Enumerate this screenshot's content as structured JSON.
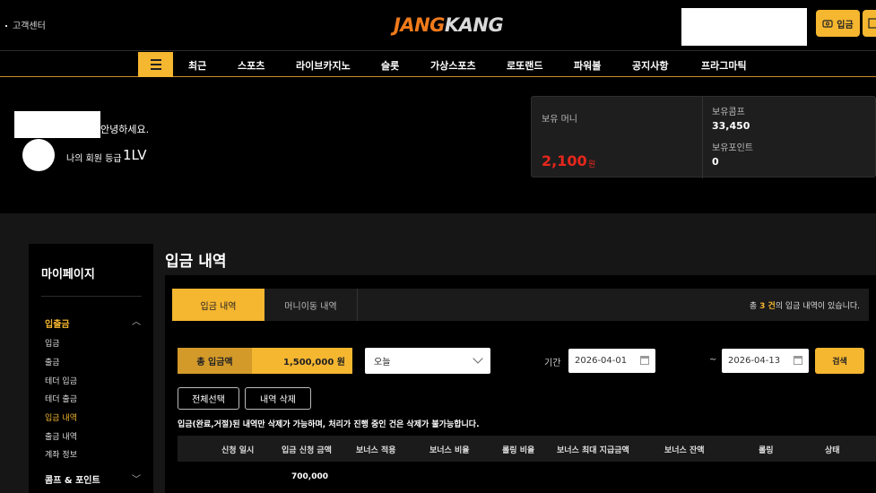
{
  "header": {
    "support_label": "고객센터",
    "logo_part1": "JANG",
    "logo_part2": "KANG",
    "deposit_button": "입금"
  },
  "nav": {
    "items": [
      "최근",
      "스포츠",
      "라이브카지노",
      "슬롯",
      "가상스포츠",
      "로또랜드",
      "파워볼",
      "공지사항",
      "프라그마틱"
    ]
  },
  "user": {
    "greeting": "안녕하세요.",
    "grade_label": "나의 회원 등급",
    "grade_value": "1LV"
  },
  "wallet": {
    "money_label": "보유 머니",
    "money_value": "2,100",
    "money_unit": "원",
    "comp_label": "보유콤프",
    "comp_value": "33,450",
    "point_label": "보유포인트",
    "point_value": "0"
  },
  "sidebar": {
    "title": "마이페이지",
    "group1": "입출금",
    "items": [
      "입금",
      "출금",
      "테더 입금",
      "테더 출금",
      "입금 내역",
      "출금 내역",
      "계좌 정보"
    ],
    "group2": "콤프 & 포인트"
  },
  "page": {
    "title": "입금 내역"
  },
  "tabs": {
    "active": "입금 내역",
    "inactive": "머니이동 내역",
    "count_prefix": "총",
    "count_value": "3 건",
    "count_suffix": "의 입금 내역이 있습니다."
  },
  "filters": {
    "total_label": "총 입금액",
    "total_value": "1,500,000 원",
    "range_select": "오늘",
    "period_label": "기간",
    "date_from": "2026-04-01",
    "tilde": "~",
    "date_to": "2026-04-13",
    "search_button": "검색"
  },
  "actions": {
    "select_all": "전체선택",
    "delete": "내역 삭제",
    "notice": "입금(완료,거절)된 내역만 삭제가 가능하며, 처리가 진행 중인 건은 삭제가 불가능합니다."
  },
  "table": {
    "headers": [
      "신청 일시",
      "입금 신청 금액",
      "보너스 적용",
      "보너스 비율",
      "롤링 비율",
      "보너스 최대 지급금액",
      "보너스 잔액",
      "롤링",
      "상태"
    ],
    "rows": [
      {
        "amount": "700,000"
      }
    ]
  },
  "colors": {
    "accent": "#f5b630",
    "money_red": "#e8261c",
    "logo_orange": "#f07a1a"
  }
}
